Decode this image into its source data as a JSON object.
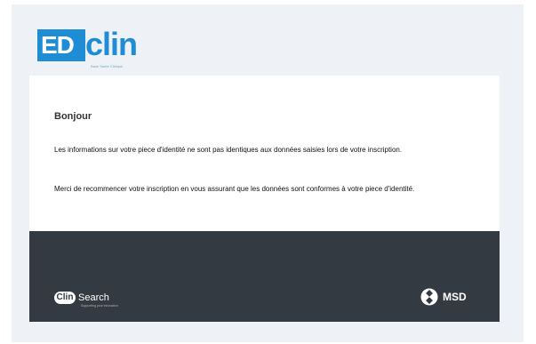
{
  "header": {
    "logo_ed": "ED",
    "logo_clin": "clin",
    "logo_tagline": "Base Santé Clinique"
  },
  "message": {
    "greeting": "Bonjour",
    "paragraph_1": "Les informations sur votre piece d'identité ne sont pas identiques aux données saisies lors de votre inscription.",
    "paragraph_2": "Merci de recommencer votre inscription en vous assurant que les données sont conformes à votre piece d'identité."
  },
  "footer": {
    "clinsearch_badge": "Clin",
    "clinsearch_word": "Search",
    "clinsearch_tagline": "Supporting your innovation",
    "msd_label": "MSD"
  },
  "colors": {
    "brand_blue": "#1f8dd6",
    "footer_bg": "#343a42",
    "frame_bg": "#eef1f5"
  },
  "icons": [
    "msd-logo-icon"
  ]
}
